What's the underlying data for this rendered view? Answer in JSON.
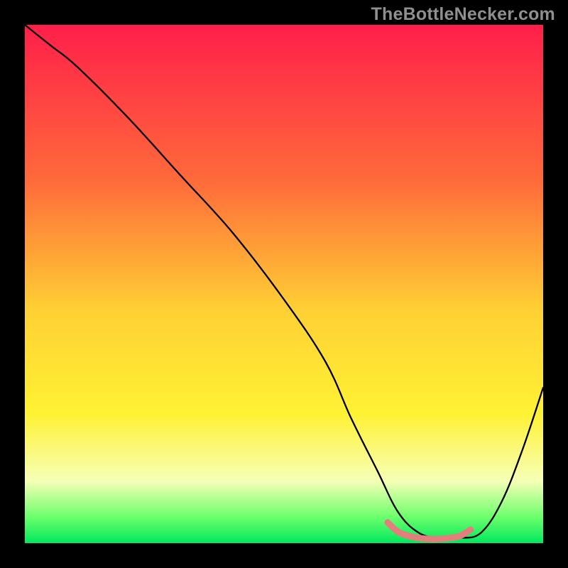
{
  "watermark": "TheBottleNecker.com",
  "chart_data": {
    "type": "line",
    "title": "",
    "xlabel": "",
    "ylabel": "",
    "xlim": [
      0,
      100
    ],
    "ylim": [
      0,
      100
    ],
    "gradient_stops": [
      {
        "offset": 0,
        "color": "#ff1f4a"
      },
      {
        "offset": 30,
        "color": "#ff6a3a"
      },
      {
        "offset": 55,
        "color": "#ffd034"
      },
      {
        "offset": 75,
        "color": "#fff233"
      },
      {
        "offset": 88,
        "color": "#f6ffb7"
      },
      {
        "offset": 95,
        "color": "#6bff6b"
      },
      {
        "offset": 100,
        "color": "#00e85e"
      }
    ],
    "series": [
      {
        "name": "bottleneck-curve",
        "color": "#000000",
        "x": [
          0,
          5,
          10,
          20,
          30,
          40,
          50,
          58,
          63,
          68,
          72,
          76,
          80,
          84,
          88,
          92,
          96,
          100
        ],
        "y": [
          100,
          96,
          92,
          82,
          71,
          60,
          47,
          35,
          24,
          14,
          6,
          2,
          1,
          1,
          2,
          8,
          18,
          30
        ]
      },
      {
        "name": "optimal-marker",
        "color": "#e67d7d",
        "x": [
          70,
          72,
          74,
          76,
          78,
          80,
          82,
          84,
          86
        ],
        "y": [
          4,
          2.2,
          1.4,
          1.0,
          0.8,
          0.8,
          1.0,
          1.4,
          2.6
        ]
      }
    ]
  }
}
